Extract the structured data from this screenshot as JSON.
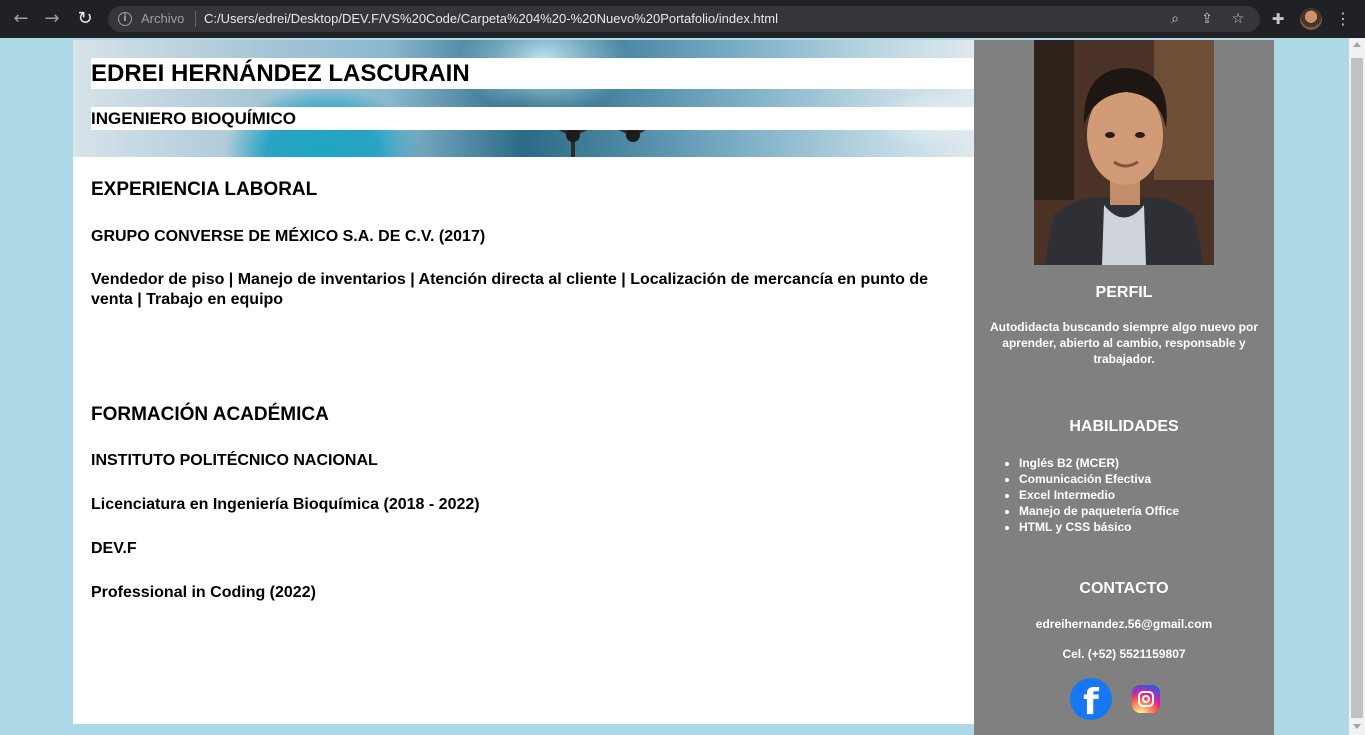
{
  "browser": {
    "scheme_label": "Archivo",
    "url": "C:/Users/edrei/Desktop/DEV.F/VS%20Code/Carpeta%204%20-%20Nuevo%20Portafolio/index.html"
  },
  "header": {
    "name": "EDREI HERNÁNDEZ LASCURAIN",
    "role": "INGENIERO BIOQUÍMICO"
  },
  "experience": {
    "heading": "EXPERIENCIA LABORAL",
    "company": "GRUPO CONVERSE DE MÉXICO S.A. DE C.V. (2017)",
    "details": "Vendedor de piso | Manejo de inventarios | Atención directa al cliente | Localización de mercancía en punto de venta | Trabajo en equipo"
  },
  "education": {
    "heading": "FORMACIÓN ACADÉMICA",
    "items": [
      "INSTITUTO POLITÉCNICO NACIONAL",
      "Licenciatura en Ingeniería Bioquímica (2018 - 2022)",
      "DEV.F",
      "Professional in Coding (2022)"
    ]
  },
  "sidebar": {
    "profile_heading": "PERFIL",
    "profile_text": "Autodidacta buscando siempre algo nuevo por aprender, abierto al cambio, responsable y trabajador.",
    "skills_heading": "HABILIDADES",
    "skills": [
      "Inglés B2 (MCER)",
      "Comunicación Efectiva",
      "Excel Intermedio",
      "Manejo de paquetería Office",
      "HTML y CSS básico"
    ],
    "contact_heading": "CONTACTO",
    "email": "edreihernandez.56@gmail.com",
    "phone": "Cel. (+52) 5521159807",
    "facebook_glyph": "f"
  },
  "colors": {
    "page_bg": "#add8e6",
    "sidebar_bg": "#808080",
    "facebook_blue": "#1877f2"
  }
}
